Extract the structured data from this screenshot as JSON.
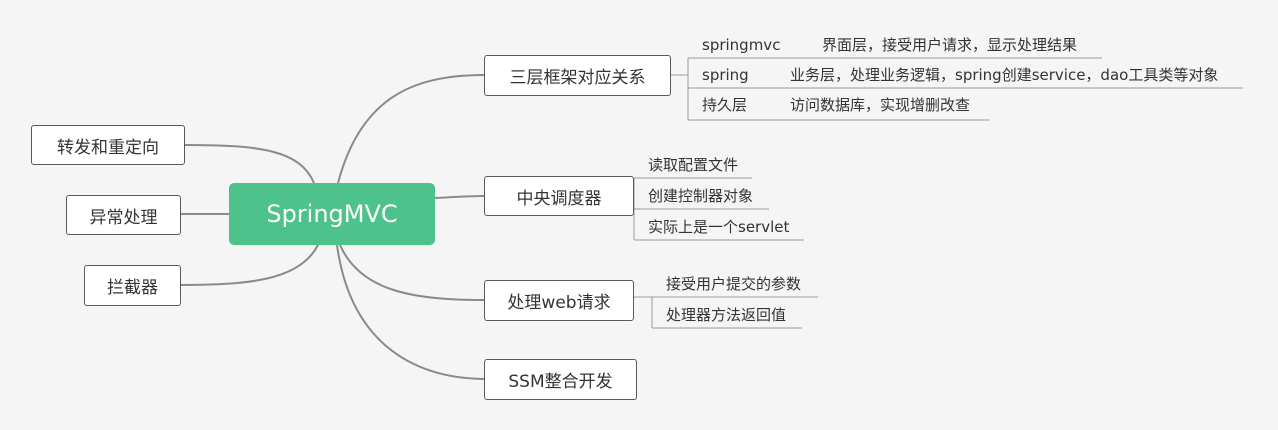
{
  "colors": {
    "background": "#f5f5f5",
    "root_fill": "#4dc28a",
    "connector": "#8a8a8a",
    "underline": "#9a9a9a"
  },
  "root": {
    "label": "SpringMVC"
  },
  "left_branches": [
    {
      "label": "转发和重定向"
    },
    {
      "label": "异常处理"
    },
    {
      "label": "拦截器"
    }
  ],
  "right_branches": [
    {
      "label": "三层框架对应关系",
      "children": [
        {
          "label": "springmvc",
          "desc": "界面层，接受用户请求，显示处理结果"
        },
        {
          "label": "spring",
          "desc": "业务层，处理业务逻辑，spring创建service，dao工具类等对象"
        },
        {
          "label": "持久层",
          "desc": "访问数据库，实现增删改查"
        }
      ]
    },
    {
      "label": "中央调度器",
      "children": [
        {
          "label": "读取配置文件"
        },
        {
          "label": "创建控制器对象"
        },
        {
          "label": "实际上是一个servlet"
        }
      ]
    },
    {
      "label": "处理web请求",
      "children": [
        {
          "label": "接受用户提交的参数"
        },
        {
          "label": "处理器方法返回值"
        }
      ]
    },
    {
      "label": "SSM整合开发",
      "children": []
    }
  ]
}
